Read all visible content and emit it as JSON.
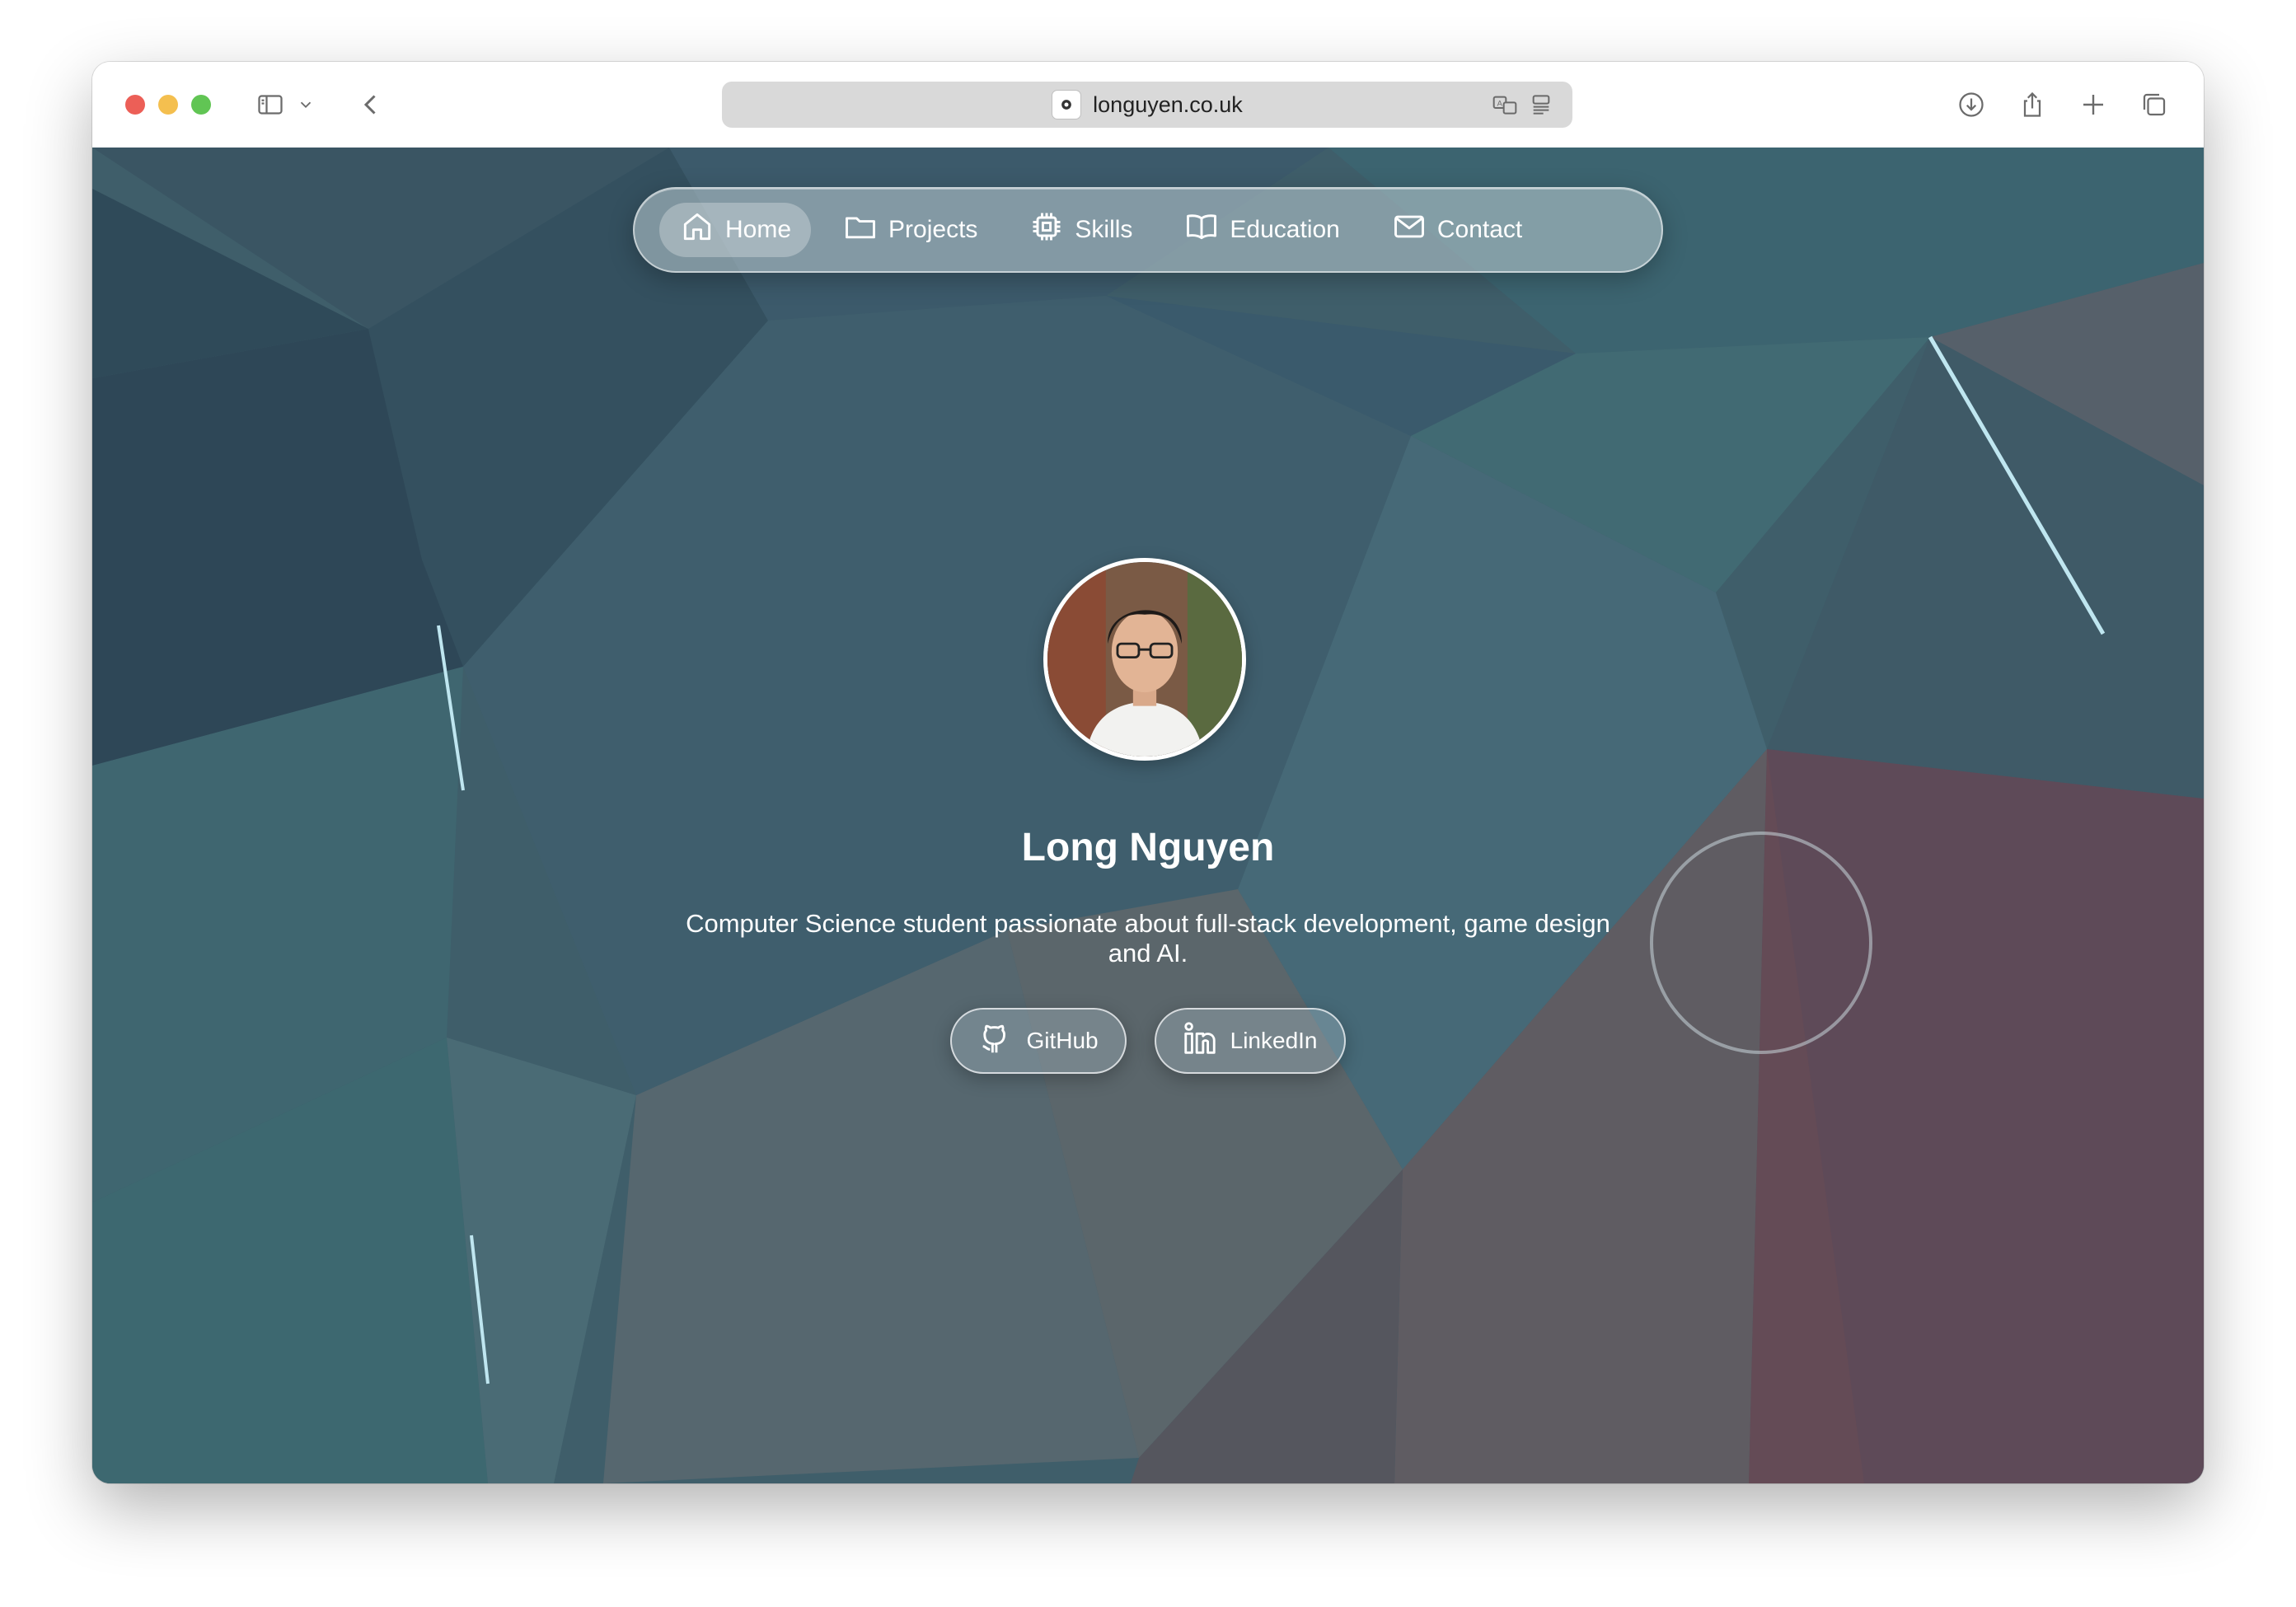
{
  "browser": {
    "url": "longuyen.co.uk"
  },
  "nav": {
    "items": [
      {
        "label": "Home",
        "icon": "home-icon",
        "active": true
      },
      {
        "label": "Projects",
        "icon": "folder-icon",
        "active": false
      },
      {
        "label": "Skills",
        "icon": "chip-icon",
        "active": false
      },
      {
        "label": "Education",
        "icon": "book-icon",
        "active": false
      },
      {
        "label": "Contact",
        "icon": "mail-icon",
        "active": false
      }
    ]
  },
  "hero": {
    "name": "Long Nguyen",
    "bio": "Computer Science student passionate about full-stack development, game design and AI.",
    "links": [
      {
        "label": "GitHub",
        "icon": "github-icon"
      },
      {
        "label": "LinkedIn",
        "icon": "linkedin-icon"
      }
    ]
  },
  "colors": {
    "background": "#3e5f6a",
    "accent_white": "#ffffff"
  }
}
